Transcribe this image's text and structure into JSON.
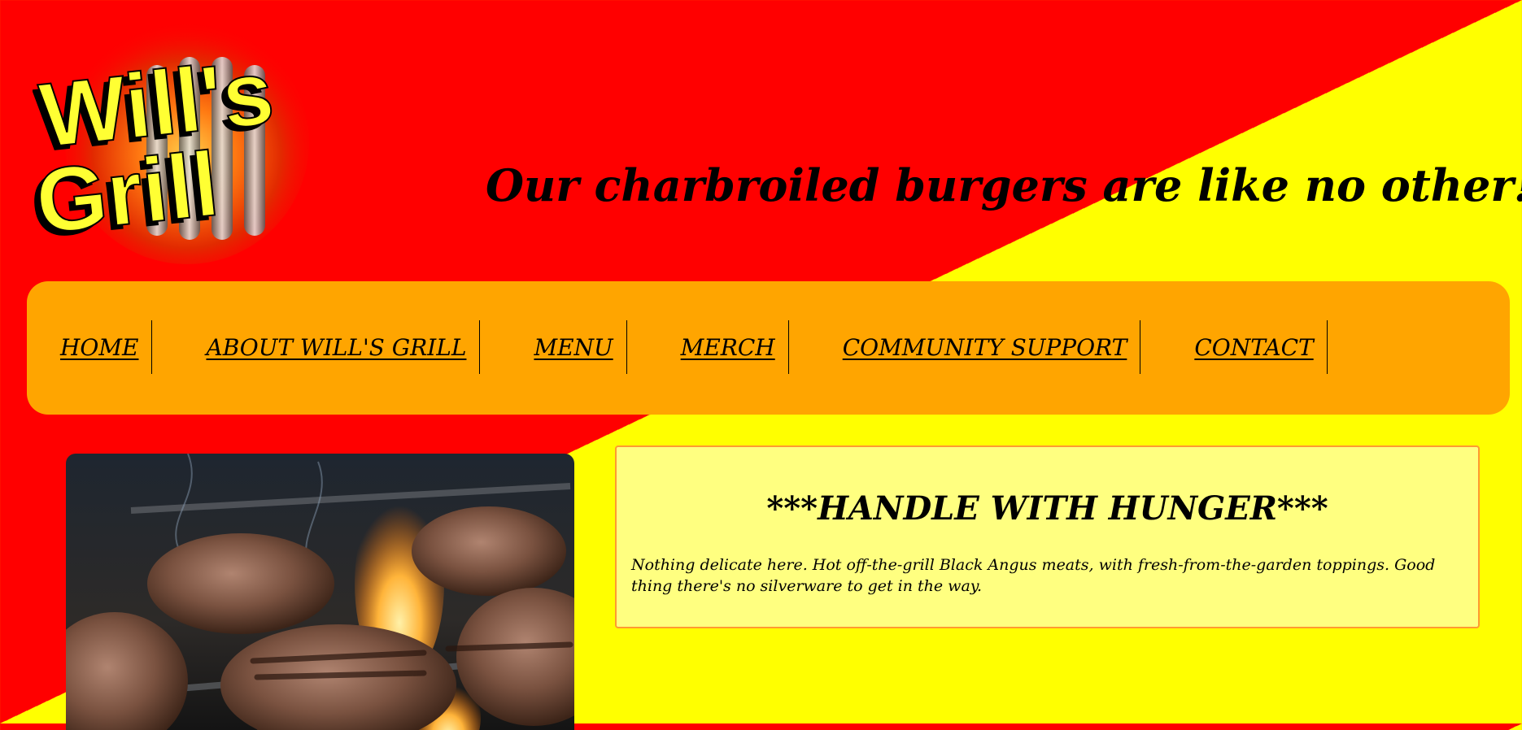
{
  "header": {
    "logo": {
      "line1": "Will's",
      "line2": "Grill"
    },
    "tagline": "Our charbroiled burgers are like no other!"
  },
  "nav": {
    "items": [
      {
        "label": "HOME"
      },
      {
        "label": "ABOUT WILL'S GRILL"
      },
      {
        "label": "MENU"
      },
      {
        "label": "MERCH"
      },
      {
        "label": "COMMUNITY SUPPORT"
      },
      {
        "label": "CONTACT"
      }
    ]
  },
  "main": {
    "hero_image": {
      "subject": "burger patties on a flaming grill"
    },
    "promo": {
      "title": "***HANDLE WITH HUNGER***",
      "text": "Nothing delicate here. Hot off-the-grill Black Angus meats, with fresh-from-the-garden toppings. Good thing there's no silverware to get in the way."
    }
  },
  "colors": {
    "background_red": "#ff0000",
    "background_yellow": "#ffff00",
    "nav_orange": "#ffa500",
    "logo_yellow": "#ffff33",
    "promo_border": "#ff9a30"
  }
}
